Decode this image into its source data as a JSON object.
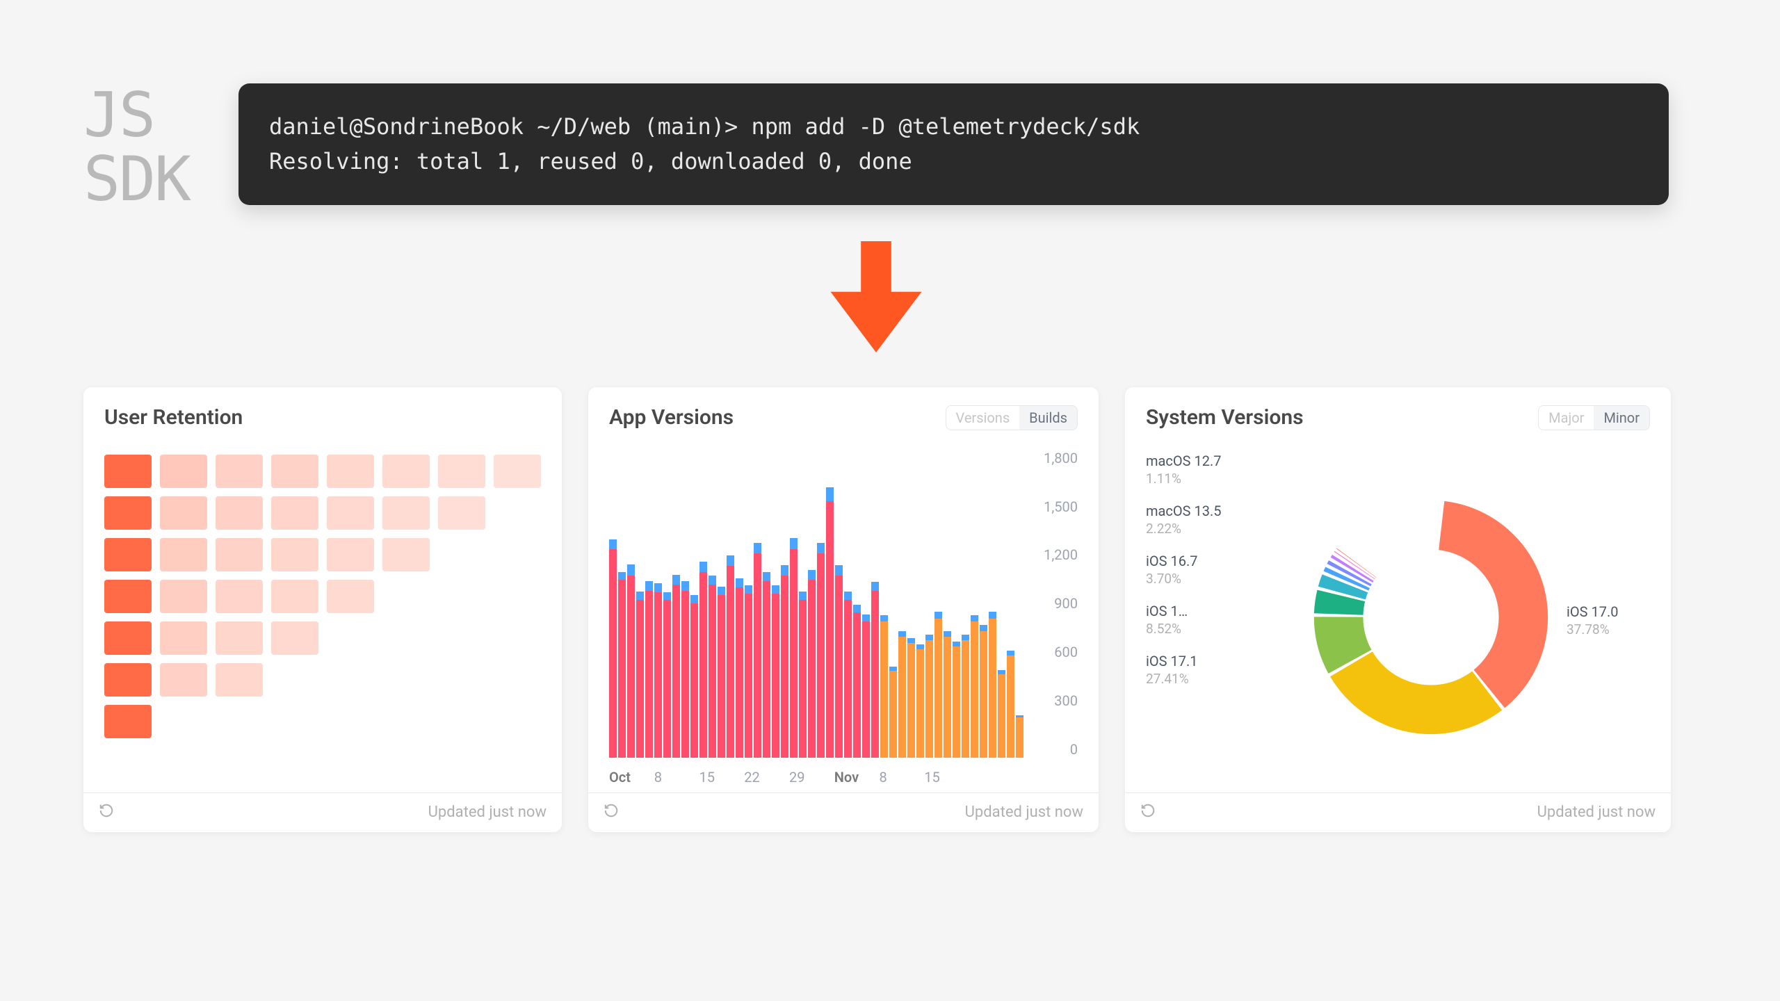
{
  "title_line1": "JS",
  "title_line2": "SDK",
  "terminal": {
    "line1": "daniel@SondrineBook ~/D/web (main)> npm add -D @telemetrydeck/sdk",
    "line2": "Resolving: total 1, reused 0, downloaded 0, done"
  },
  "footer_updated": "Updated just now",
  "cards": {
    "retention": {
      "title": "User Retention"
    },
    "app_versions": {
      "title": "App Versions",
      "pill_a": "Versions",
      "pill_b": "Builds"
    },
    "system_versions": {
      "title": "System Versions",
      "pill_a": "Major",
      "pill_b": "Minor"
    }
  },
  "chart_data": [
    {
      "id": "user_retention",
      "type": "heatmap",
      "title": "User Retention",
      "rows": 7,
      "cols": 8,
      "cells": [
        [
          1.0,
          0.45,
          0.35,
          0.32,
          0.28,
          0.24,
          0.2,
          0.16
        ],
        [
          1.0,
          0.42,
          0.34,
          0.3,
          0.26,
          0.22,
          0.18,
          null
        ],
        [
          1.0,
          0.4,
          0.33,
          0.29,
          0.25,
          0.21,
          null,
          null
        ],
        [
          1.0,
          0.38,
          0.31,
          0.27,
          0.23,
          null,
          null,
          null
        ],
        [
          1.0,
          0.36,
          0.29,
          0.25,
          null,
          null,
          null,
          null
        ],
        [
          1.0,
          0.34,
          0.27,
          null,
          null,
          null,
          null,
          null
        ],
        [
          1.0,
          null,
          null,
          null,
          null,
          null,
          null,
          null
        ]
      ],
      "colorscale_base": "#ff6b47"
    },
    {
      "id": "app_versions",
      "type": "bar",
      "title": "App Versions",
      "stacked": true,
      "ylim": [
        0,
        1800
      ],
      "yticks": [
        0,
        300,
        600,
        900,
        1200,
        1500,
        1800
      ],
      "xticks": [
        "Oct",
        "8",
        "15",
        "22",
        "29",
        "Nov",
        "8",
        "15"
      ],
      "series": [
        {
          "name": "v1 (pink)",
          "color": "#ff4d6b",
          "values": [
            1350,
            1150,
            1180,
            1020,
            1080,
            1070,
            1020,
            1120,
            1080,
            1000,
            1200,
            1120,
            1050,
            1240,
            1100,
            1060,
            1320,
            1140,
            1060,
            1180,
            1350,
            1020,
            1150,
            1320,
            1660,
            1180,
            1020,
            940,
            880,
            1080,
            0,
            0,
            0,
            0,
            0,
            0,
            0,
            0,
            0,
            0,
            0,
            0,
            0,
            0,
            0,
            0
          ]
        },
        {
          "name": "v2 (orange)",
          "color": "#ff9a3c",
          "values": [
            0,
            0,
            0,
            0,
            0,
            0,
            0,
            0,
            0,
            0,
            0,
            0,
            0,
            0,
            0,
            0,
            0,
            0,
            0,
            0,
            0,
            0,
            0,
            0,
            0,
            0,
            0,
            0,
            0,
            0,
            880,
            560,
            780,
            740,
            700,
            760,
            900,
            780,
            720,
            760,
            880,
            820,
            900,
            540,
            660,
            260
          ]
        },
        {
          "name": "v0 (blue)",
          "color": "#4aa3ff",
          "values": [
            60,
            50,
            70,
            55,
            60,
            58,
            50,
            62,
            60,
            52,
            66,
            60,
            54,
            68,
            60,
            56,
            70,
            62,
            56,
            64,
            72,
            54,
            62,
            70,
            88,
            64,
            56,
            50,
            46,
            58,
            40,
            30,
            36,
            34,
            32,
            36,
            42,
            36,
            32,
            36,
            40,
            38,
            42,
            26,
            30,
            14
          ]
        }
      ],
      "x_count": 46
    },
    {
      "id": "system_versions",
      "type": "pie",
      "title": "System Versions",
      "hole": 0.58,
      "slices": [
        {
          "name": "iOS 17.0",
          "value": 37.78,
          "color": "#ff7a5c"
        },
        {
          "name": "iOS 17.1",
          "value": 27.41,
          "color": "#f4c20d"
        },
        {
          "name": "iOS 1…",
          "value": 8.52,
          "color": "#8bc34a"
        },
        {
          "name": "iOS 16.7",
          "value": 3.7,
          "color": "#1db082"
        },
        {
          "name": "macOS 13.5",
          "value": 2.22,
          "color": "#33b6cc"
        },
        {
          "name": "macOS 12.7",
          "value": 1.11,
          "color": "#4aa3ff"
        },
        {
          "name": "other-a",
          "value": 1.0,
          "color": "#7e8bff",
          "hidden_label": true
        },
        {
          "name": "other-b",
          "value": 0.9,
          "color": "#c07eff",
          "hidden_label": true
        },
        {
          "name": "other-c",
          "value": 0.6,
          "color": "#ff7ad1",
          "hidden_label": true
        },
        {
          "name": "other-d",
          "value": 0.4,
          "color": "#ff7a5c",
          "hidden_label": true
        },
        {
          "name": "remainder",
          "value": 16.36,
          "color": "transparent",
          "hidden_label": true,
          "gap": true
        }
      ]
    }
  ]
}
